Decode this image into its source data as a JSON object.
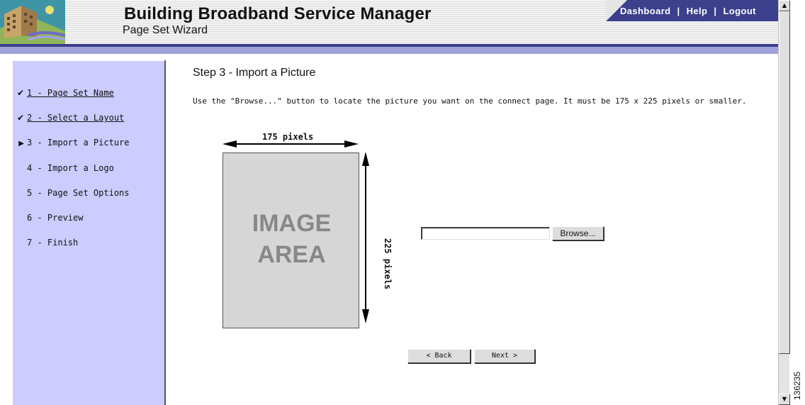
{
  "header": {
    "title": "Building Broadband Service Manager",
    "subtitle": "Page Set Wizard",
    "nav": [
      "Dashboard",
      "Help",
      "Logout"
    ],
    "separator": "|"
  },
  "sidebar": {
    "steps": [
      {
        "label": "1 - Page Set Name",
        "state": "done",
        "mark": "✔"
      },
      {
        "label": "2 - Select a Layout",
        "state": "done",
        "mark": "✔"
      },
      {
        "label": "3 - Import a Picture",
        "state": "current",
        "mark": "▶"
      },
      {
        "label": "4 - Import a Logo",
        "state": "pending",
        "mark": ""
      },
      {
        "label": "5 - Page Set Options",
        "state": "pending",
        "mark": ""
      },
      {
        "label": "6 - Preview",
        "state": "pending",
        "mark": ""
      },
      {
        "label": "7 - Finish",
        "state": "pending",
        "mark": ""
      }
    ]
  },
  "main": {
    "step_title": "Step 3 - Import a Picture",
    "instructions": "Use the \"Browse...\" button to locate the picture you want on the connect page. It must be 175 x 225 pixels or smaller.",
    "diagram": {
      "width_label": "175 pixels",
      "height_label": "225 pixels",
      "area_line1": "IMAGE",
      "area_line2": "AREA"
    },
    "file_input_value": "",
    "browse_label": "Browse...",
    "back_label": "< Back",
    "next_label": "Next >"
  },
  "figure_id": "136235",
  "colors": {
    "sidebar_bg": "#ccccff",
    "header_accent": "#3b3f8c",
    "header_light": "#9fa3d9",
    "image_area": "#d6d6d6"
  }
}
